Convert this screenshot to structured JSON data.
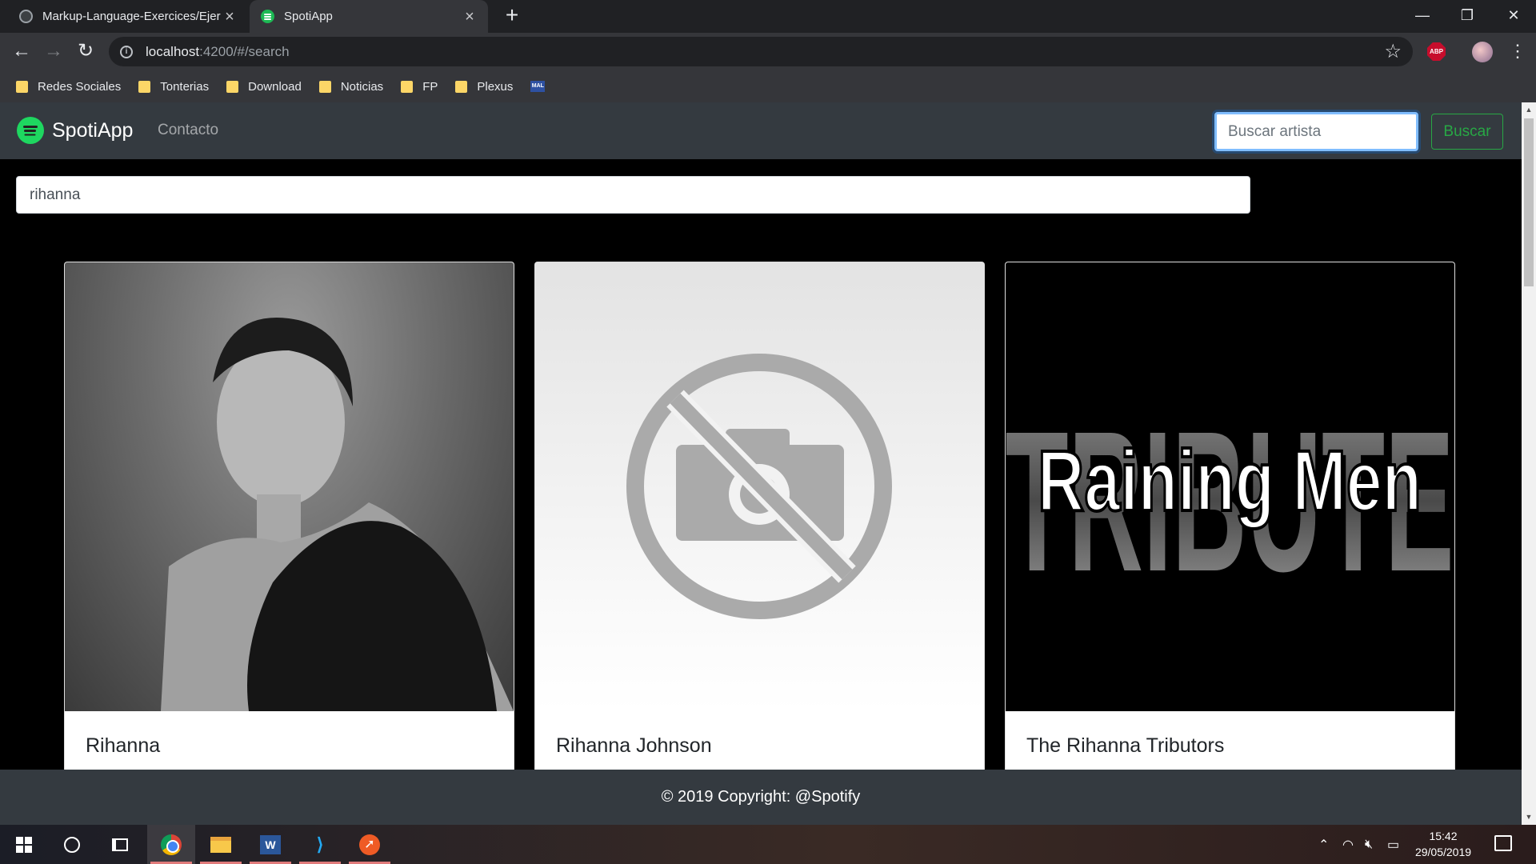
{
  "browser": {
    "tabs": [
      {
        "title": "Markup-Language-Exercices/Ejer",
        "icon": "github-icon",
        "active": false
      },
      {
        "title": "SpotiApp",
        "icon": "spotify-icon",
        "active": true
      }
    ],
    "url_host": "localhost",
    "url_path": ":4200/#/search",
    "bookmarks": [
      {
        "label": "Redes Sociales"
      },
      {
        "label": "Tonterias"
      },
      {
        "label": "Download"
      },
      {
        "label": "Noticias"
      },
      {
        "label": "FP"
      },
      {
        "label": "Plexus"
      }
    ],
    "bookmark_mal_icon": "MAL",
    "abp_label": "ABP"
  },
  "app": {
    "brand": "SpotiApp",
    "nav_contact": "Contacto",
    "nav_search_placeholder": "Buscar artista",
    "nav_search_button": "Buscar",
    "search_value": "rihanna",
    "cards": [
      {
        "title": "Rihanna",
        "image": "artist-photo"
      },
      {
        "title": "Rihanna Johnson",
        "image": "no-image-placeholder"
      },
      {
        "title": "The Rihanna Tributors",
        "image": "tribute-cover",
        "cover_text": "Raining Men",
        "cover_bg_text": "TRIBUTE"
      }
    ],
    "footer": "© 2019 Copyright: @Spotify"
  },
  "taskbar": {
    "apps": [
      "start",
      "cortana",
      "task-view",
      "chrome",
      "file-explorer",
      "word",
      "vscode",
      "postman"
    ],
    "word_letter": "W",
    "time": "15:42",
    "date": "29/05/2019"
  },
  "colors": {
    "navbar_bg": "#343a40",
    "spotify_green": "#1ed760",
    "button_green": "#28a745",
    "focus_blue": "#80bdff"
  }
}
